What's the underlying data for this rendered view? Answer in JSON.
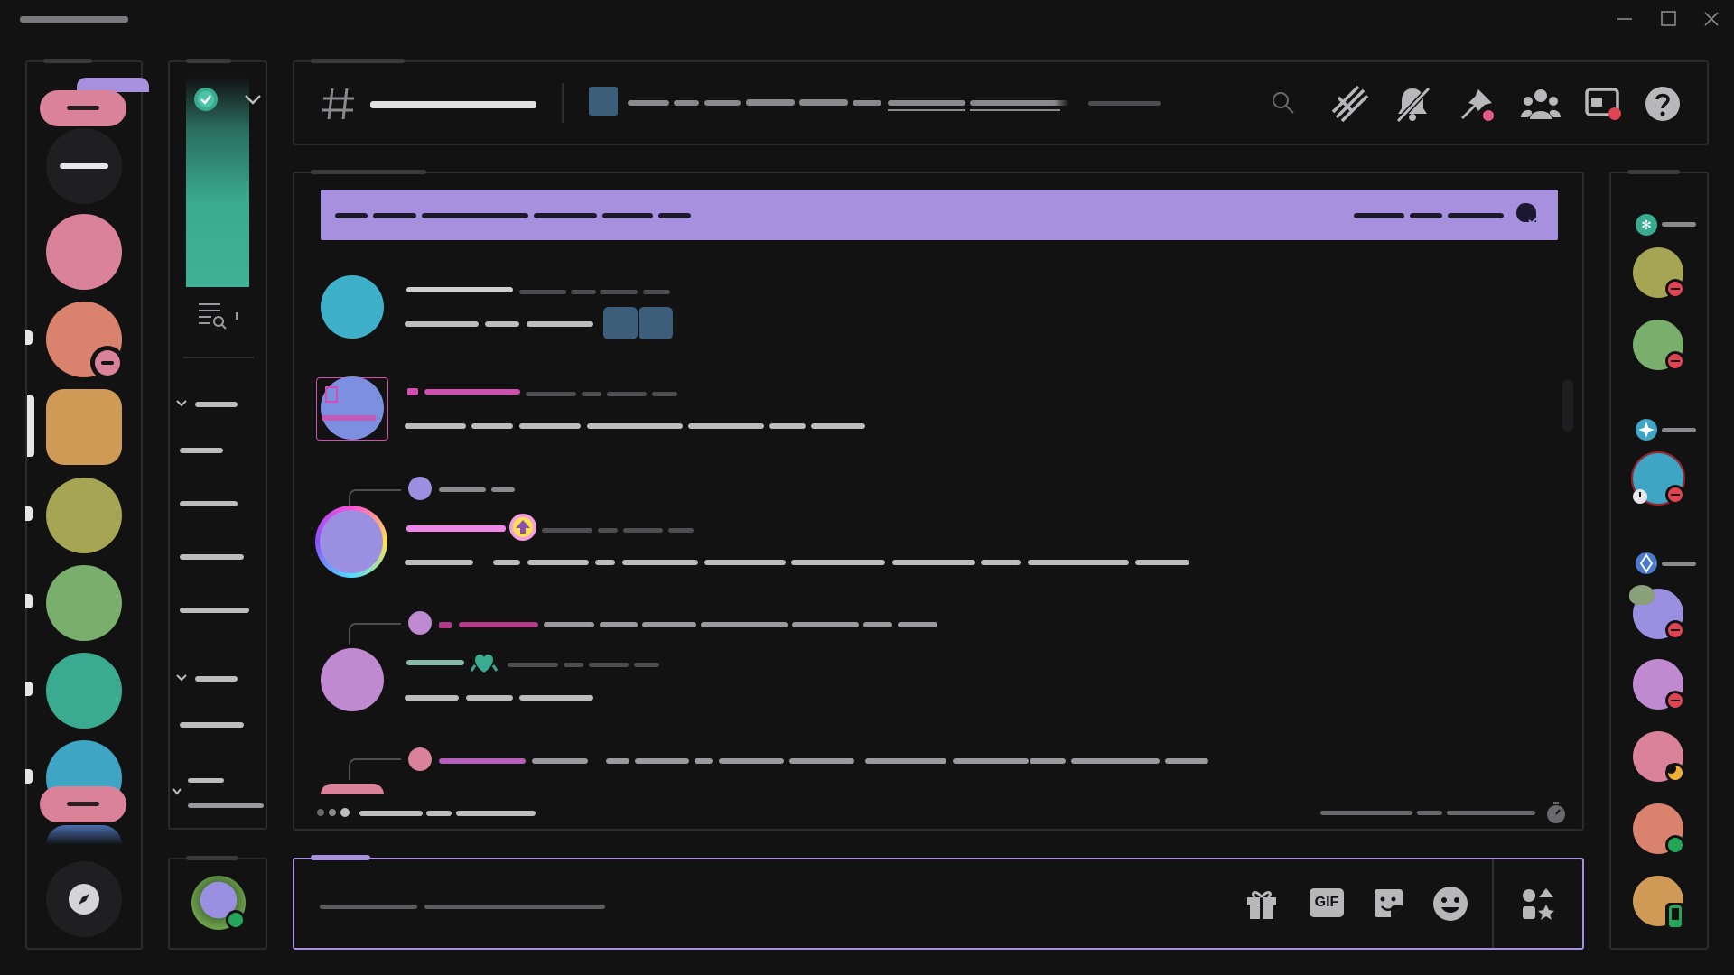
{
  "window": {
    "title": "",
    "controls": [
      "minimize",
      "maximize",
      "close"
    ]
  },
  "colors": {
    "background": "#121213",
    "frame": "#2b2b2e",
    "banner": "#a791df",
    "accent_purple": "#a791df",
    "accent_teal": "#3aab91",
    "danger": "#e04452",
    "online": "#25a559",
    "idle": "#f0b132"
  },
  "servers": [
    {
      "name": "server-pink",
      "color": "#d9829a"
    },
    {
      "name": "server-salmon",
      "color": "#d9836f",
      "badge": "dnd"
    },
    {
      "name": "server-orange-selected",
      "color": "#ce9a56",
      "selected": true
    },
    {
      "name": "server-olive",
      "color": "#a6a553"
    },
    {
      "name": "server-green",
      "color": "#7aae6d"
    },
    {
      "name": "server-teal",
      "color": "#3aab91"
    },
    {
      "name": "server-cyan",
      "color": "#3fa5c4"
    }
  ],
  "channel_header": {
    "icon": "hash-icon",
    "toolbar": [
      "search-icon",
      "threads-icon",
      "mute-icon",
      "pin-icon",
      "members-icon",
      "inbox-icon",
      "help-icon"
    ]
  },
  "input": {
    "icons": [
      "gift-icon",
      "gif-icon",
      "sticker-icon",
      "emoji-icon",
      "apps-icon"
    ],
    "gif_label": "GIF"
  },
  "messages": [
    {
      "avatar_color": "#3fb0c9",
      "name_color": "#cfcfd1"
    },
    {
      "avatar_color": "#7c8fe0",
      "name_color": "#d04fb0"
    },
    {
      "avatar_color": "#9a8fe0",
      "name_color": "#ee86ea",
      "reply": true
    },
    {
      "avatar_color": "#c08ad0",
      "name_color": "#86b9a6",
      "reply": true
    },
    {
      "avatar_color": "#d9829a",
      "name_color": "#b45fb9",
      "reply": true
    }
  ],
  "members": [
    {
      "color": "#a6a553",
      "status": "dnd"
    },
    {
      "color": "#7aae6d",
      "status": "dnd"
    },
    {
      "color": "#3fa5c4",
      "status": "dnd"
    },
    {
      "color": "#9a8fe0",
      "status": "dnd"
    },
    {
      "color": "#c08ad0",
      "status": "dnd"
    },
    {
      "color": "#d9829a",
      "status": "idle"
    },
    {
      "color": "#d9836f",
      "status": "online"
    },
    {
      "color": "#ce9a56",
      "status": "mobile"
    }
  ]
}
